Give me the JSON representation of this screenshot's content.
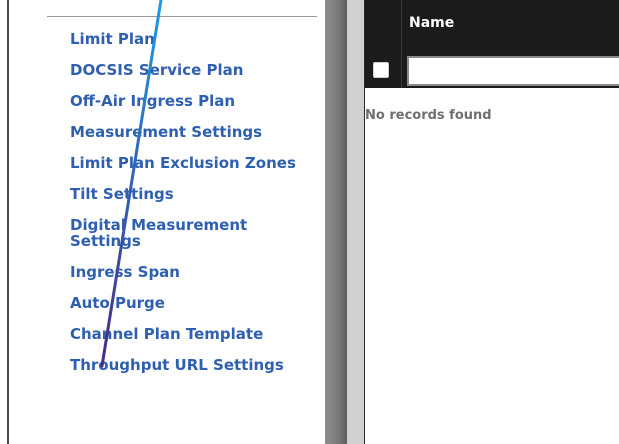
{
  "settings_menu": {
    "items": [
      {
        "label": "Limit Plan"
      },
      {
        "label": "DOCSIS Service Plan"
      },
      {
        "label": "Off-Air Ingress Plan"
      },
      {
        "label": "Measurement Settings"
      },
      {
        "label": "Limit Plan Exclusion Zones"
      },
      {
        "label": "Tilt Settings"
      },
      {
        "label": "Digital Measurement Settings"
      },
      {
        "label": "Ingress Span"
      },
      {
        "label": "Auto Purge"
      },
      {
        "label": "Channel Plan Template"
      },
      {
        "label": "Throughput URL Settings"
      }
    ]
  },
  "grid": {
    "columns": [
      {
        "label": "Name"
      }
    ],
    "filter": {
      "value": "",
      "placeholder": ""
    },
    "empty_message": "No records found"
  },
  "colors": {
    "link": "#2e5fb0",
    "header_bg": "#1b1b1b",
    "annotation_stroke_start": "#1e9be0",
    "annotation_stroke_end": "#4a2a86"
  }
}
